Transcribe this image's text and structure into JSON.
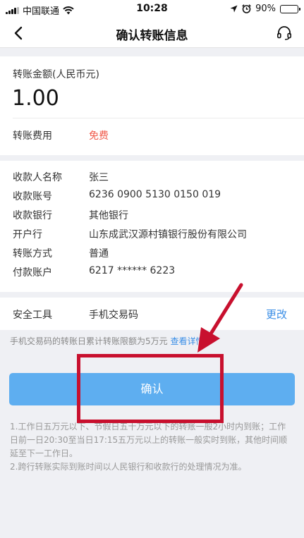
{
  "status_bar": {
    "carrier": "中国联通",
    "time": "10:28",
    "battery": "90%",
    "battery_level": 0.9,
    "icons": [
      "signal-icon",
      "wifi-icon",
      "location-icon",
      "alarm-icon",
      "battery-icon"
    ]
  },
  "nav": {
    "title": "确认转账信息",
    "back_icon": "chevron-left-icon",
    "service_icon": "headset-icon"
  },
  "amount": {
    "label": "转账金额(人民币元)",
    "value": "1.00"
  },
  "fee": {
    "label": "转账费用",
    "value": "免费",
    "color": "#f05a4a"
  },
  "details": [
    {
      "label": "收款人名称",
      "value": "张三"
    },
    {
      "label": "收款账号",
      "value": "6236 0900 5130 0150 019"
    },
    {
      "label": "收款银行",
      "value": "其他银行"
    },
    {
      "label": "开户行",
      "value": "山东成武汉源村镇银行股份有限公司"
    },
    {
      "label": "转账方式",
      "value": "普通"
    },
    {
      "label": "付款账户",
      "value": "6217 ****** 6223"
    }
  ],
  "security": {
    "label": "安全工具",
    "value": "手机交易码",
    "change": "更改"
  },
  "limit_note": {
    "text": "手机交易码的转账日累计转账限额为5万元",
    "link": "查看详情"
  },
  "confirm_button": "确认",
  "notes": [
    "1.工作日五万元以下、节假日五十万元以下的转账一般2小时内到账；工作日前一日20:30至当日17:15五万元以上的转账一般实时到账，其他时间顺延至下一工作日。",
    "2.跨行转账实际到账时间以人民银行和收款行的处理情况为准。"
  ],
  "colors": {
    "accent": "#3a8ee6",
    "button": "#5eaef0",
    "annotation": "#c8102e"
  }
}
